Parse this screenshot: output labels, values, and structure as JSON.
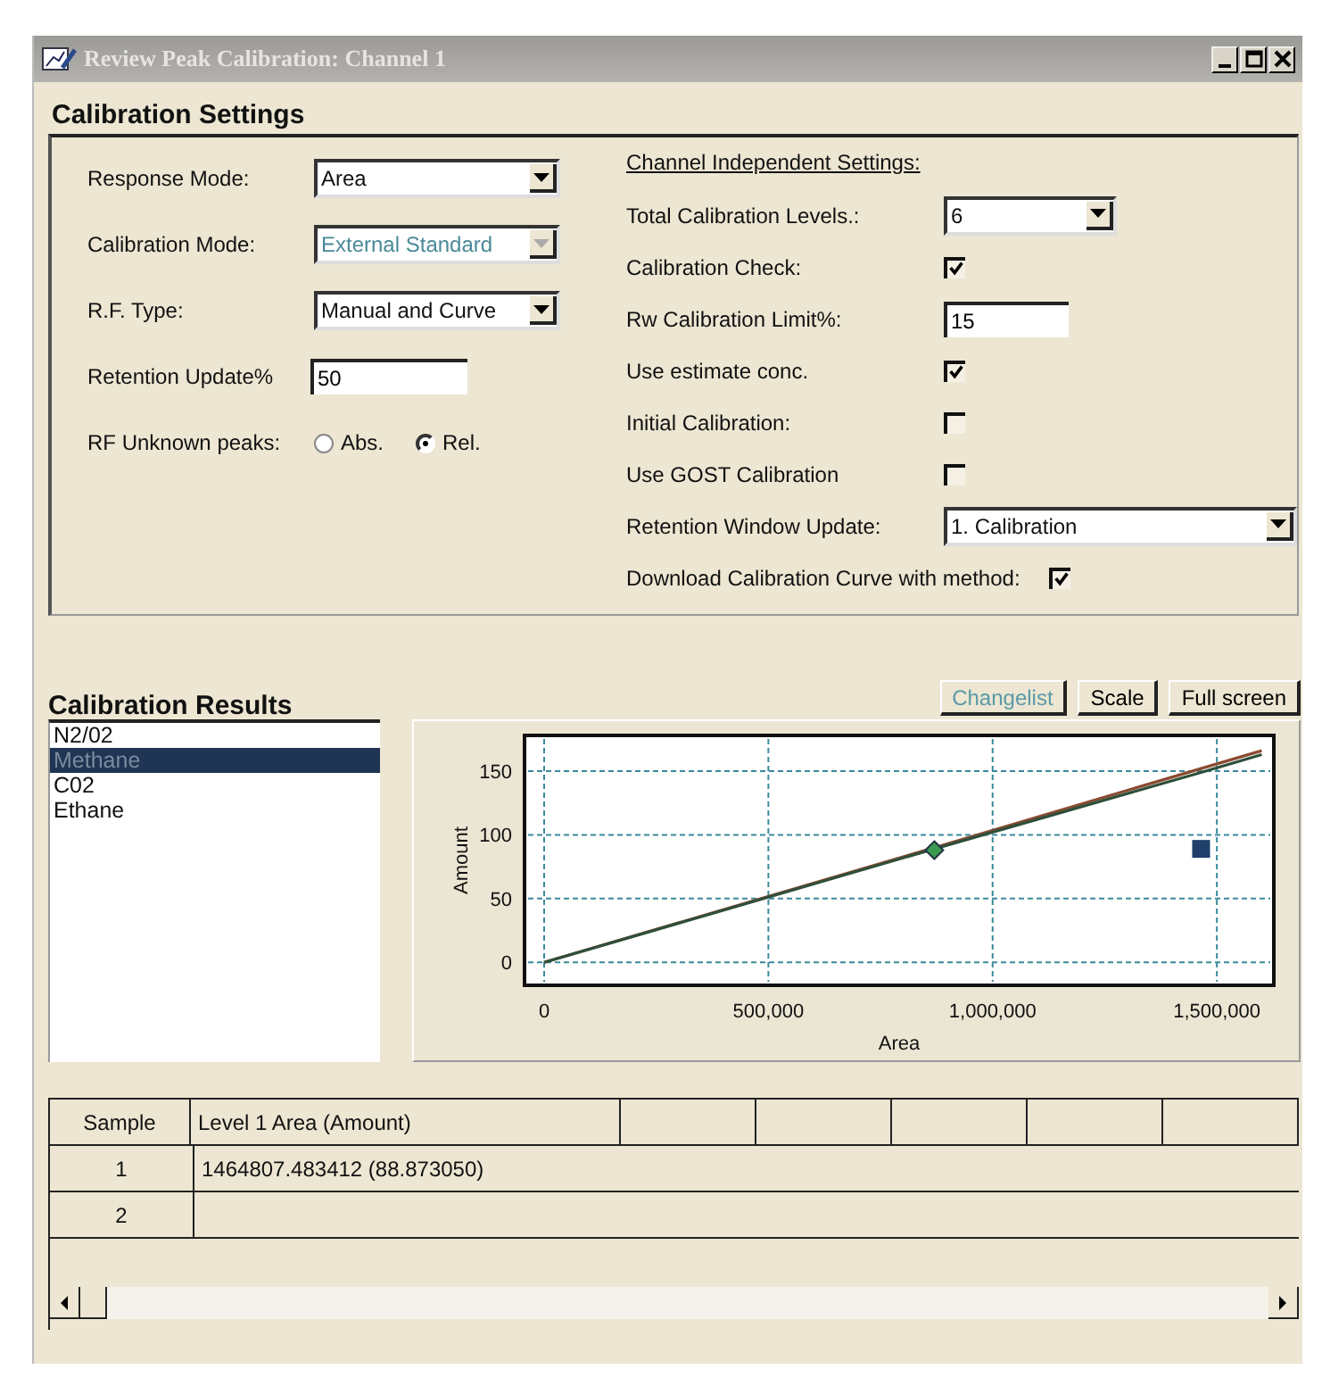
{
  "window": {
    "title": "Review Peak Calibration: Channel 1"
  },
  "settings": {
    "title": "Calibration Settings",
    "left": [
      {
        "kind": "dropdown",
        "label": "Response Mode:",
        "value": "Area",
        "disabled": false
      },
      {
        "kind": "dropdown",
        "label": "Calibration Mode:",
        "value": "External Standard",
        "disabled": true
      },
      {
        "kind": "dropdown",
        "label": "R.F. Type:",
        "value": "Manual and Curve",
        "disabled": false
      },
      {
        "kind": "text",
        "label": "Retention Update%",
        "value": "50"
      },
      {
        "kind": "radio",
        "label": "RF Unknown peaks:",
        "options": [
          {
            "label": "Abs.",
            "selected": false
          },
          {
            "label": "Rel.",
            "selected": true
          }
        ]
      }
    ],
    "right_heading": "Channel Independent Settings:",
    "right": [
      {
        "kind": "dropdown",
        "label": "Total Calibration Levels.:",
        "value": "6",
        "disabled": false
      },
      {
        "kind": "checkbox",
        "label": "Calibration Check:",
        "checked": true
      },
      {
        "kind": "text",
        "label": "Rw Calibration Limit%:",
        "value": "15"
      },
      {
        "kind": "checkbox",
        "label": "Use estimate conc.",
        "checked": true
      },
      {
        "kind": "checkbox",
        "label": "Initial Calibration:",
        "checked": false
      },
      {
        "kind": "checkbox",
        "label": "Use GOST Calibration",
        "checked": false
      },
      {
        "kind": "dropdown-wide",
        "label": "Retention Window Update:",
        "value": "1. Calibration",
        "disabled": false
      },
      {
        "kind": "checkbox-inline",
        "label": "Download Calibration Curve with method:",
        "checked": true
      }
    ]
  },
  "results": {
    "title": "Calibration Results",
    "items": [
      {
        "label": "N2/02",
        "selected": false
      },
      {
        "label": "Methane",
        "selected": true
      },
      {
        "label": "C02",
        "selected": false
      },
      {
        "label": "Ethane",
        "selected": false
      }
    ],
    "buttons": [
      {
        "label": "Changelist",
        "disabled": true
      },
      {
        "label": "Scale",
        "disabled": false
      },
      {
        "label": "Full screen",
        "disabled": false
      }
    ],
    "chart_data": {
      "type": "line",
      "xlabel": "Area",
      "ylabel": "Amount",
      "x": [
        0,
        870000,
        1464807,
        1600000
      ],
      "grid": true,
      "series": [
        {
          "color": "#8a4a30",
          "values": [
            0,
            90,
            152,
            166
          ]
        },
        {
          "color": "#2f4f3a",
          "values": [
            0,
            89,
            149,
            163
          ]
        },
        {
          "color": "#3c9a50",
          "marker": "diamond",
          "values": [
            null,
            88,
            null,
            null
          ]
        },
        {
          "color": "#1f3f6a",
          "marker": "square",
          "values": [
            null,
            null,
            89,
            null
          ]
        }
      ],
      "xlim": [
        -43767,
        1627000
      ],
      "ylim": [
        -18,
        178
      ],
      "xticks": [
        {
          "value": 0,
          "label": "0"
        },
        {
          "value": 500000,
          "label": "500,000"
        },
        {
          "value": 1000000,
          "label": "1,000,000"
        },
        {
          "value": 1500000,
          "label": "1,500,000"
        }
      ],
      "yticks": [
        0,
        50,
        100,
        150
      ]
    }
  },
  "table": {
    "columns": [
      "Sample",
      "Level 1 Area (Amount)"
    ],
    "rows": [
      {
        "cells": [
          "1",
          "1464807.483412 (88.873050)"
        ]
      },
      {
        "cells": [
          "2"
        ]
      }
    ]
  }
}
